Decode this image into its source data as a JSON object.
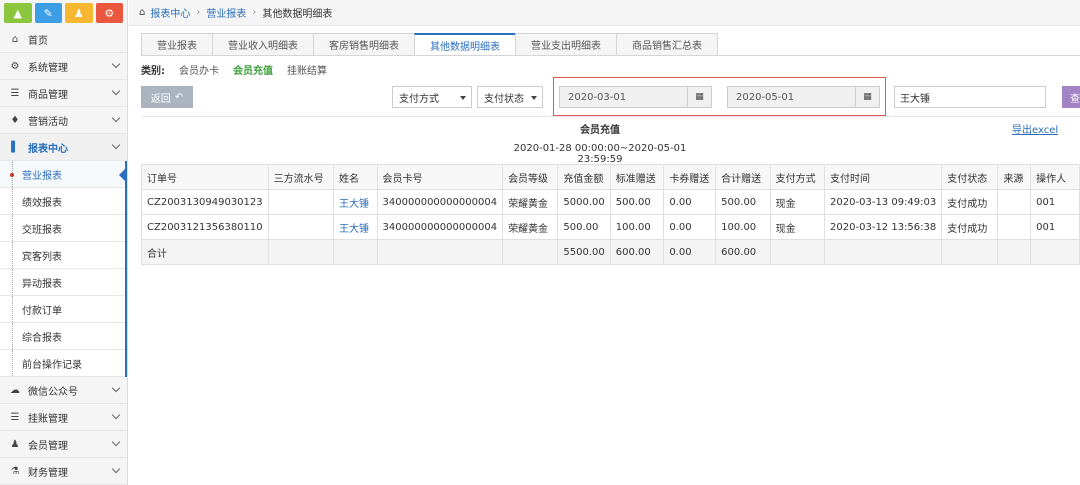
{
  "colors": {
    "accent": "#2a6fbd",
    "active_category": "#3aa037",
    "highlight": "#e05a4e",
    "query": "#a283c4",
    "top_icons": [
      "#8cc63f",
      "#3c9ee5",
      "#f7b731",
      "#e9573f"
    ]
  },
  "top_icons": [
    "signal-icon",
    "pencil-icon",
    "users-icon",
    "cogs-icon"
  ],
  "sidebar": {
    "items": [
      {
        "label": "首页",
        "icon": "home-icon"
      },
      {
        "label": "系统管理",
        "icon": "gear-icon"
      },
      {
        "label": "商品管理",
        "icon": "database-icon"
      },
      {
        "label": "营销活动",
        "icon": "gift-icon"
      },
      {
        "label": "报表中心",
        "icon": "chart-icon"
      }
    ],
    "sub_items": [
      {
        "label": "营业报表"
      },
      {
        "label": "绩效报表"
      },
      {
        "label": "交班报表"
      },
      {
        "label": "宾客列表"
      },
      {
        "label": "异动报表"
      },
      {
        "label": "付款订单"
      },
      {
        "label": "综合报表"
      },
      {
        "label": "前台操作记录"
      }
    ],
    "bottom_items": [
      {
        "label": "微信公众号",
        "icon": "cloud-icon"
      },
      {
        "label": "挂账管理",
        "icon": "list-icon"
      },
      {
        "label": "会员管理",
        "icon": "group-icon"
      },
      {
        "label": "财务管理",
        "icon": "cutlery-icon"
      }
    ]
  },
  "breadcrumb": [
    "报表中心",
    "营业报表",
    "其他数据明细表"
  ],
  "tabs": [
    "营业报表",
    "营业收入明细表",
    "客房销售明细表",
    "其他数据明细表",
    "营业支出明细表",
    "商品销售汇总表"
  ],
  "category": {
    "label": "类别:",
    "options": [
      "会员办卡",
      "会员充值",
      "挂账结算"
    ]
  },
  "filters": {
    "back": "返回",
    "pay_method": "支付方式",
    "pay_status": "支付状态",
    "start_date": "2020-03-01",
    "end_date": "2020-05-01",
    "operator": "王大锤",
    "query": "查"
  },
  "report": {
    "title": "会员充值",
    "export": "导出excel",
    "range": "2020-01-28 00:00:00~2020-05-01 23:59:59"
  },
  "table": {
    "headers": [
      "订单号",
      "三方流水号",
      "姓名",
      "会员卡号",
      "会员等级",
      "充值金额",
      "标准赠送",
      "卡券赠送",
      "合计赠送",
      "支付方式",
      "支付时间",
      "支付状态",
      "来源",
      "操作人"
    ],
    "rows": [
      [
        "CZ2003130949030123",
        "",
        "王大锤",
        "340000000000000004",
        "荣耀黄金",
        "5000.00",
        "500.00",
        "0.00",
        "500.00",
        "现金",
        "2020-03-13 09:49:03",
        "支付成功",
        "",
        "001"
      ],
      [
        "CZ2003121356380110",
        "",
        "王大锤",
        "340000000000000004",
        "荣耀黄金",
        "500.00",
        "100.00",
        "0.00",
        "100.00",
        "现金",
        "2020-03-12 13:56:38",
        "支付成功",
        "",
        "001"
      ]
    ],
    "total": [
      "合计",
      "",
      "",
      "",
      "",
      "5500.00",
      "600.00",
      "0.00",
      "600.00",
      "",
      "",
      "",
      "",
      ""
    ]
  }
}
